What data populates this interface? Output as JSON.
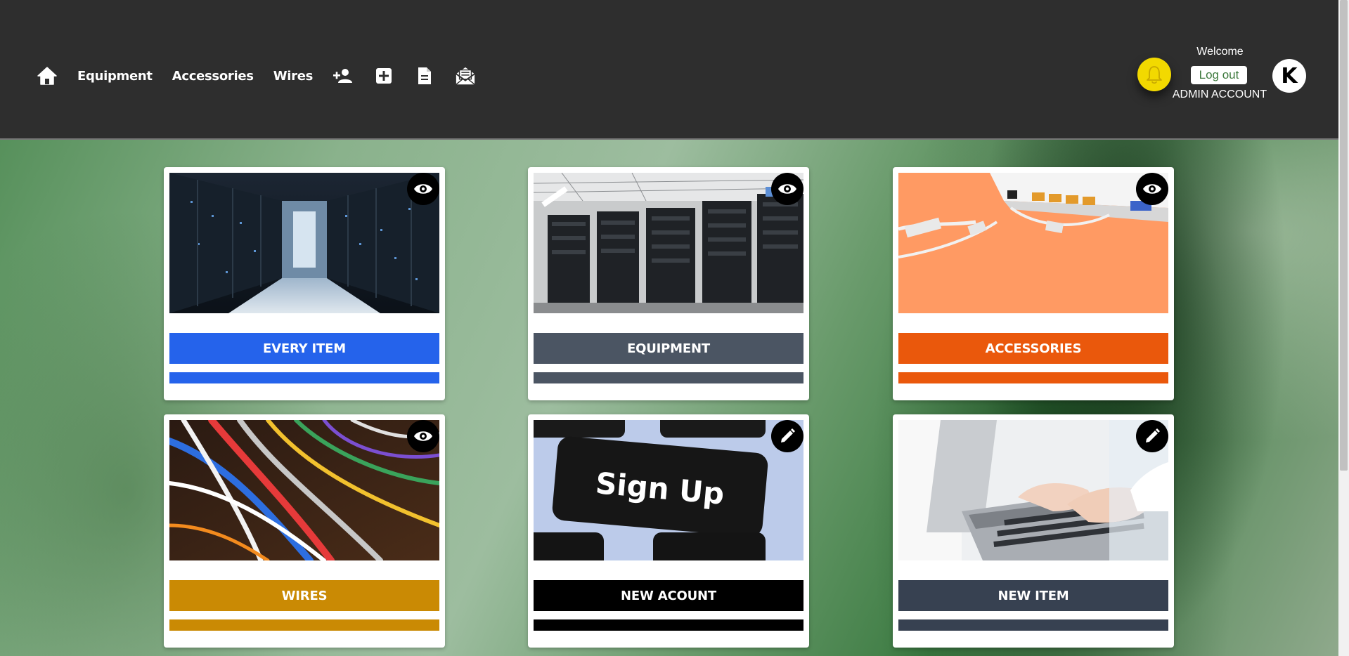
{
  "nav": {
    "links": [
      "Equipment",
      "Accessories",
      "Wires"
    ]
  },
  "user": {
    "welcome": "Welcome",
    "logout_label": "Log out",
    "account_label": "ADMIN ACCOUNT",
    "avatar_letter": "K"
  },
  "cards": [
    {
      "label": "EVERY ITEM",
      "color": "#2563eb",
      "action_icon": "eye-icon",
      "image": "server-room-aisle"
    },
    {
      "label": "EQUIPMENT",
      "color": "#4b5563",
      "action_icon": "eye-icon",
      "image": "server-racks"
    },
    {
      "label": "ACCESSORIES",
      "color": "#ea580c",
      "action_icon": "eye-icon",
      "image": "router-cables"
    },
    {
      "label": "WIRES",
      "color": "#ca8a04",
      "action_icon": "eye-icon",
      "image": "colored-wires"
    },
    {
      "label": "NEW ACOUNT",
      "color": "#000000",
      "action_icon": "pencil-icon",
      "image": "sign-up-key"
    },
    {
      "label": "NEW ITEM",
      "color": "#374151",
      "action_icon": "pencil-icon",
      "image": "laptop-typing"
    }
  ],
  "images": {
    "sign_up_key_text": "Sign Up"
  },
  "colors": {
    "header_bg": "#2e2e2e",
    "bell": "#f2d900",
    "logout_text": "#3e7a3e"
  }
}
